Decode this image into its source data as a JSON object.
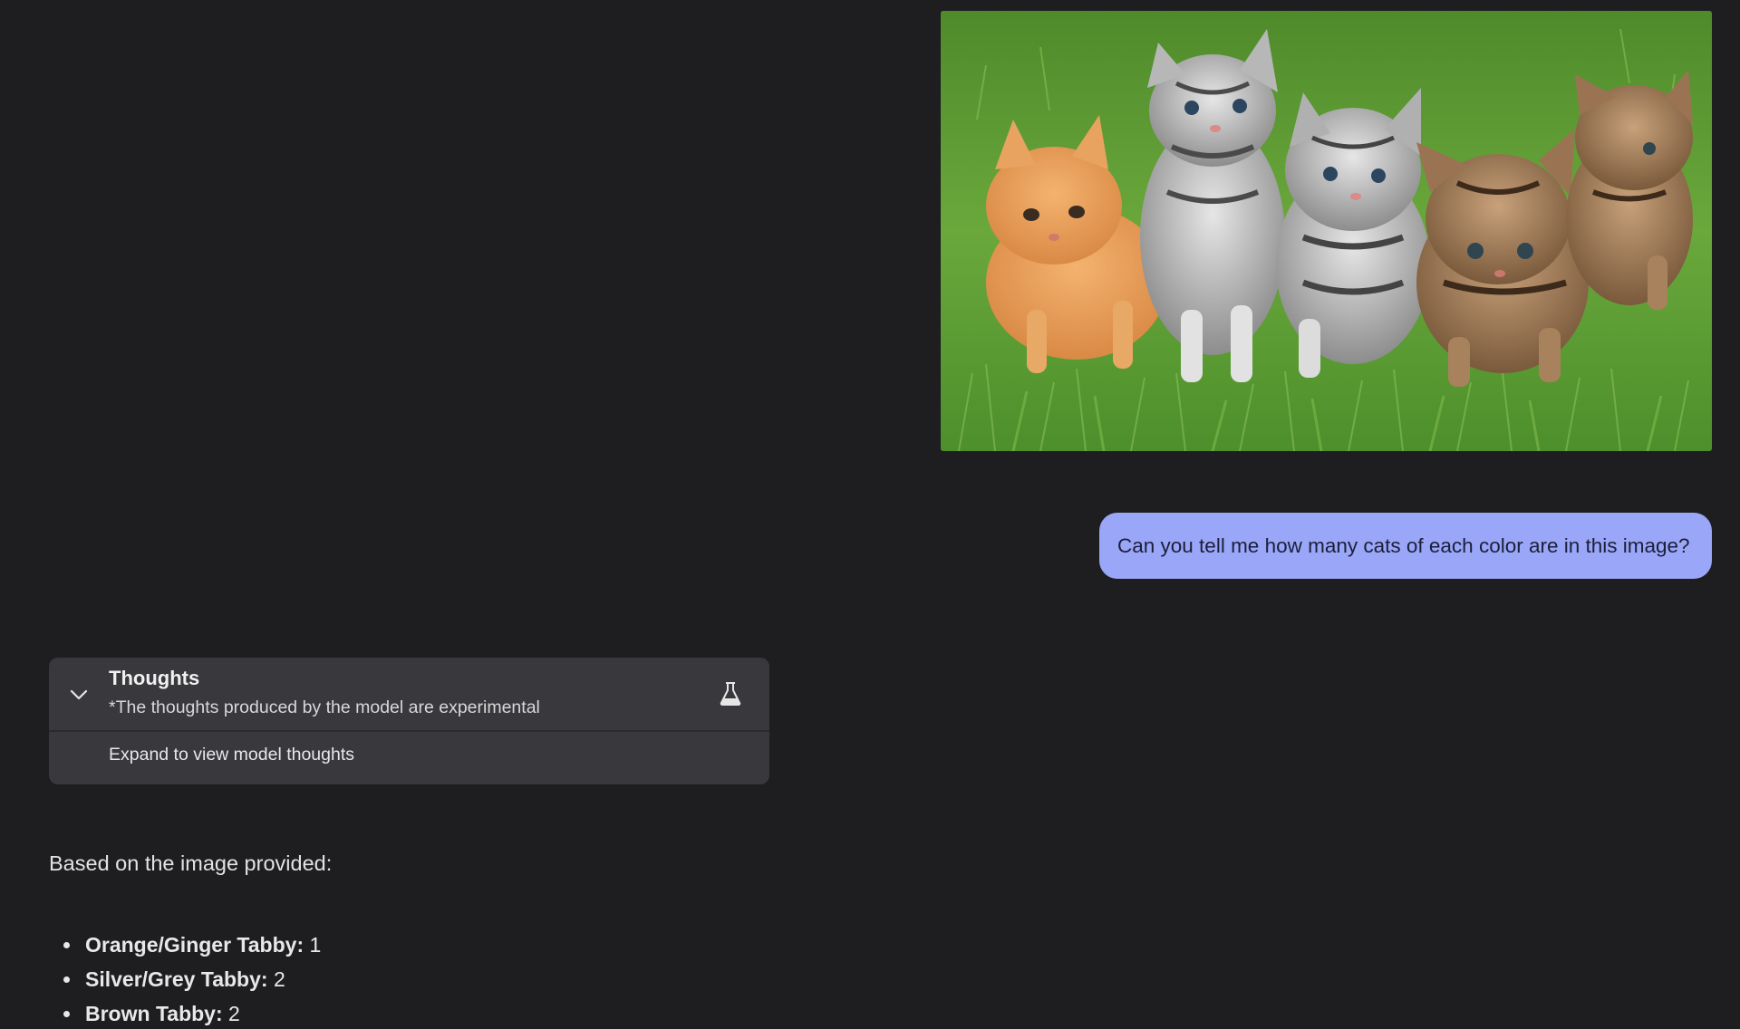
{
  "chat": {
    "user_message": "Can you tell me how many cats of each color are in this image?",
    "uploaded_image_alt": "kittens-on-grass-image"
  },
  "thoughts": {
    "title": "Thoughts",
    "subtitle": "*The thoughts produced by the model are experimental",
    "expand_label": "Expand to view model thoughts",
    "toggle_icon": "chevron-down-icon",
    "badge_icon": "flask-icon"
  },
  "response": {
    "intro": "Based on the image provided:",
    "items": [
      {
        "label": "Orange/Ginger Tabby:",
        "value": "1"
      },
      {
        "label": "Silver/Grey Tabby:",
        "value": "2"
      },
      {
        "label": "Brown Tabby:",
        "value": "2"
      }
    ]
  },
  "colors": {
    "background": "#1e1e21",
    "user_bubble": "#9aa6f7",
    "panel": "#38383d"
  }
}
